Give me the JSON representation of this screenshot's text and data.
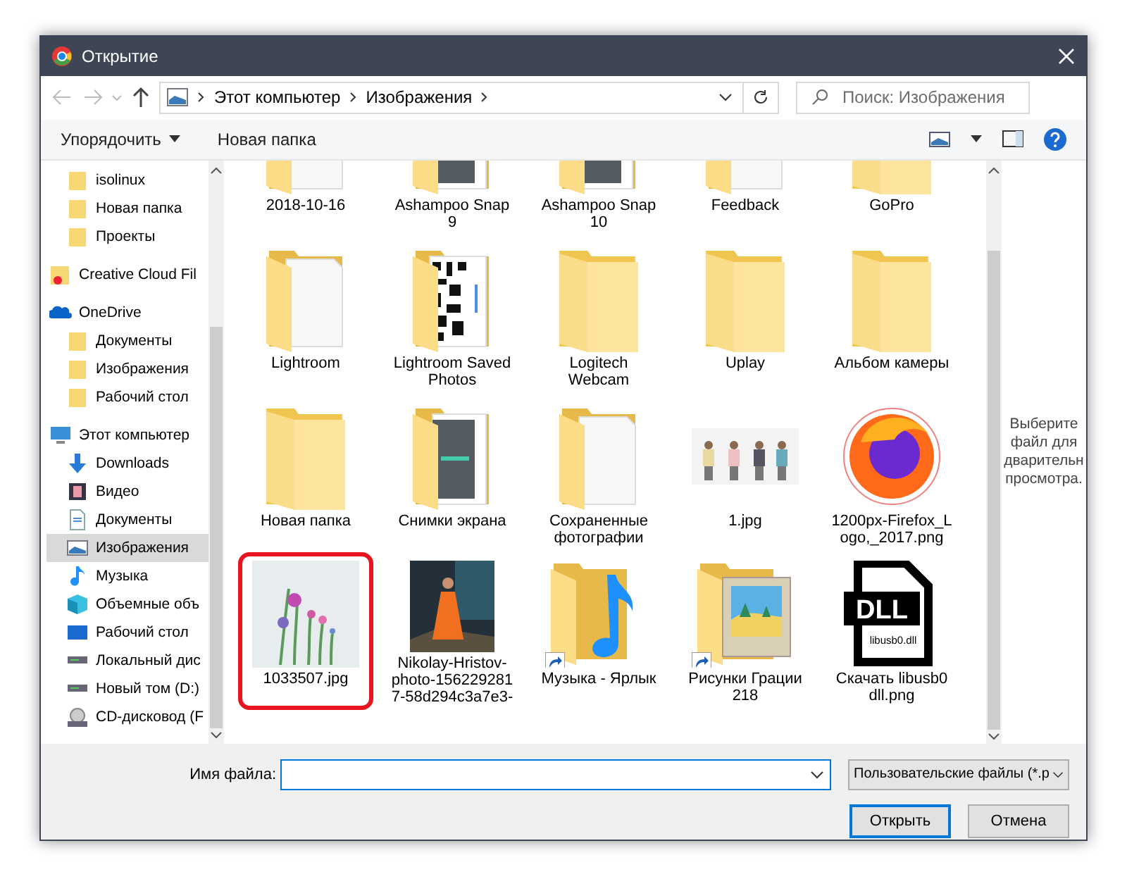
{
  "window": {
    "title": "Открытие"
  },
  "address": {
    "path": [
      "Этот компьютер",
      "Изображения"
    ],
    "search_placeholder": "Поиск: Изображения"
  },
  "toolbar": {
    "organize": "Упорядочить",
    "new_folder": "Новая папка"
  },
  "nav": [
    {
      "children": [
        {
          "label": "isolinux",
          "kind": "folder",
          "selected": false
        },
        {
          "label": "Новая папка",
          "kind": "folder",
          "selected": false
        },
        {
          "label": "Проекты",
          "kind": "folder",
          "selected": false
        }
      ]
    },
    {
      "label": "Creative Cloud Fil",
      "kind": "cloud-folder",
      "selected": false
    },
    {
      "label": "OneDrive",
      "kind": "onedrive",
      "selected": false,
      "children": [
        {
          "label": "Документы",
          "kind": "folder",
          "selected": false
        },
        {
          "label": "Изображения",
          "kind": "folder",
          "selected": false
        },
        {
          "label": "Рабочий стол",
          "kind": "folder",
          "selected": false
        }
      ]
    },
    {
      "label": "Этот компьютер",
      "kind": "pc",
      "selected": false,
      "children": [
        {
          "label": "Downloads",
          "kind": "downloads",
          "selected": false
        },
        {
          "label": "Видео",
          "kind": "video",
          "selected": false
        },
        {
          "label": "Документы",
          "kind": "docs",
          "selected": false
        },
        {
          "label": "Изображения",
          "kind": "pictures",
          "selected": true
        },
        {
          "label": "Музыка",
          "kind": "music",
          "selected": false
        },
        {
          "label": "Объемные объ",
          "kind": "cube",
          "selected": false
        },
        {
          "label": "Рабочий стол",
          "kind": "desktop",
          "selected": false
        },
        {
          "label": "Локальный дис",
          "kind": "drive",
          "selected": false
        },
        {
          "label": "Новый том (D:)",
          "kind": "drive",
          "selected": false
        },
        {
          "label": "CD-дисковод (F",
          "kind": "cd",
          "selected": false
        }
      ]
    }
  ],
  "items": [
    {
      "kind": "folder-pages",
      "label_lines": [
        "2018-10-16"
      ],
      "highlighted": false
    },
    {
      "kind": "folder-screens",
      "label_lines": [
        "Ashampoo Snap",
        "9"
      ],
      "highlighted": false
    },
    {
      "kind": "folder-screens",
      "label_lines": [
        "Ashampoo Snap",
        "10"
      ],
      "highlighted": false
    },
    {
      "kind": "folder-pages",
      "label_lines": [
        "Feedback"
      ],
      "highlighted": false
    },
    {
      "kind": "folder",
      "label_lines": [
        "GoPro"
      ],
      "highlighted": false
    },
    {
      "kind": "folder-pages",
      "label_lines": [
        "Lightroom"
      ],
      "highlighted": false
    },
    {
      "kind": "folder-qr",
      "label_lines": [
        "Lightroom Saved",
        "Photos"
      ],
      "highlighted": false
    },
    {
      "kind": "folder",
      "label_lines": [
        "Logitech",
        "Webcam"
      ],
      "highlighted": false
    },
    {
      "kind": "folder",
      "label_lines": [
        "Uplay"
      ],
      "highlighted": false
    },
    {
      "kind": "folder",
      "label_lines": [
        "Альбом камеры"
      ],
      "highlighted": false
    },
    {
      "kind": "folder",
      "label_lines": [
        "Новая папка"
      ],
      "highlighted": false
    },
    {
      "kind": "folder-screens",
      "label_lines": [
        "Снимки экрана"
      ],
      "highlighted": false
    },
    {
      "kind": "folder-pages",
      "label_lines": [
        "Сохраненные",
        "фотографии"
      ],
      "highlighted": false
    },
    {
      "kind": "photo-people",
      "label_lines": [
        "1.jpg"
      ],
      "highlighted": false
    },
    {
      "kind": "logo-image",
      "label_lines": [
        "1200px-Firefox_L",
        "ogo,_2017.png"
      ],
      "highlighted": false
    },
    {
      "kind": "photo-flowers",
      "label_lines": [
        "1033507.jpg"
      ],
      "highlighted": true
    },
    {
      "kind": "photo-portrait",
      "label_lines": [
        "Nikolay-Hristov-",
        "photo-156229281",
        "7-58d294c3a7e3-"
      ],
      "highlighted": false
    },
    {
      "kind": "music-shortcut",
      "label_lines": [
        "Музыка - Ярлык"
      ],
      "highlighted": false
    },
    {
      "kind": "pictures-shortcut",
      "label_lines": [
        "Рисунки Грации",
        "218"
      ],
      "highlighted": false
    },
    {
      "kind": "dll-image",
      "label_lines": [
        "Скачать libusb0",
        "dll.png"
      ],
      "thumb_texts": [
        "DLL",
        "libusb0.dll"
      ],
      "highlighted": false
    }
  ],
  "preview": {
    "text": "Выберите файл для дварительн просмотра."
  },
  "footer": {
    "filename_label": "Имя файла:",
    "filter": "Пользовательские файлы (*.p",
    "buttons": [
      {
        "label": "Открыть",
        "default": true
      },
      {
        "label": "Отмена",
        "default": false
      }
    ]
  }
}
